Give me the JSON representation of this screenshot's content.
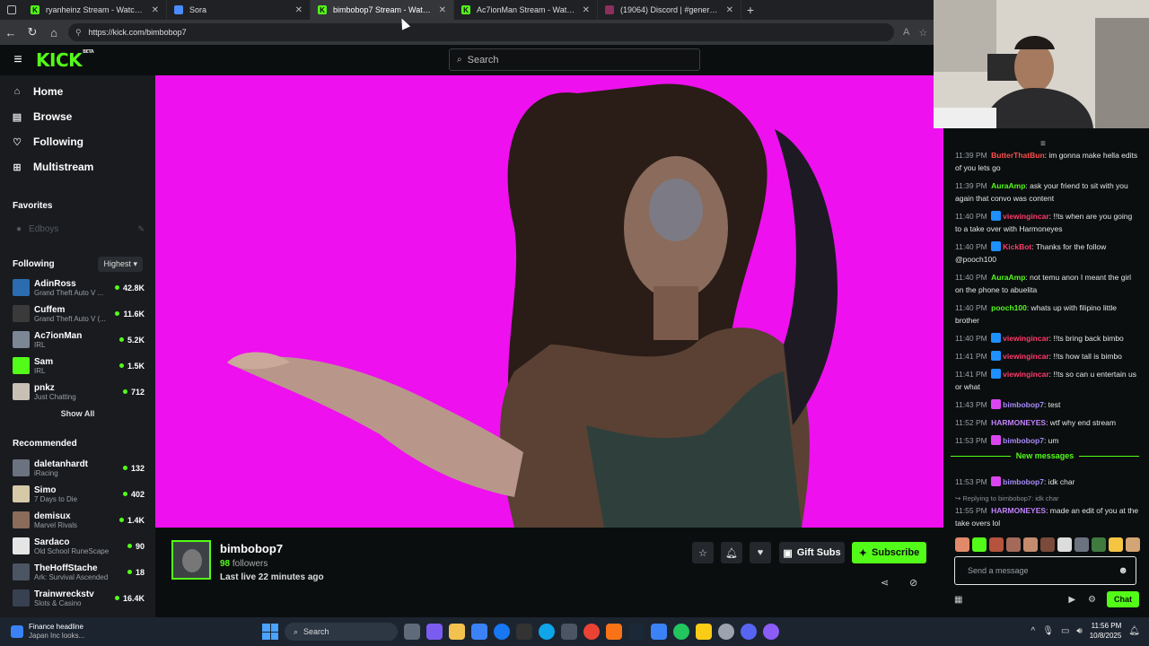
{
  "browser": {
    "tabs": [
      {
        "label": "ryanheinz Stream - Watch Li",
        "favicon": "kick",
        "color": "#53fc18",
        "active": false
      },
      {
        "label": "Sora",
        "favicon": "sora",
        "color": "#4a8cff",
        "active": false
      },
      {
        "label": "bimbobop7 Stream - Watch Live",
        "favicon": "kick",
        "color": "#53fc18",
        "active": true
      },
      {
        "label": "Ac7ionMan Stream - Watch Live",
        "favicon": "kick",
        "color": "#53fc18",
        "active": false
      },
      {
        "label": "(19064) Discord | #general | Harm",
        "favicon": "discord",
        "color": "#8d2f5c",
        "active": false
      }
    ],
    "url": "https://kick.com/bimbobop7"
  },
  "header": {
    "logo": "KICK",
    "logo_tag": "BETA",
    "search_placeholder": "Search"
  },
  "sidebar": {
    "nav": [
      {
        "label": "Home",
        "icon": "home-icon",
        "glyph": "⌂"
      },
      {
        "label": "Browse",
        "icon": "browse-icon",
        "glyph": "▤"
      },
      {
        "label": "Following",
        "icon": "heart-icon",
        "glyph": "♡"
      },
      {
        "label": "Multistream",
        "icon": "grid-icon",
        "glyph": "⊞"
      }
    ],
    "favorites_title": "Favorites",
    "favorites": [
      {
        "label": "Edboys"
      }
    ],
    "following_title": "Following",
    "sort_label": "Highest",
    "following": [
      {
        "name": "AdinRoss",
        "category": "Grand Theft Auto V ...",
        "count": "42.8K",
        "color": "#2b6cb0"
      },
      {
        "name": "Cuffem",
        "category": "Grand Theft Auto V (...",
        "count": "11.6K",
        "color": "#3a3a3a"
      },
      {
        "name": "Ac7ionMan",
        "category": "IRL",
        "count": "5.2K",
        "color": "#7c8795"
      },
      {
        "name": "Sam",
        "category": "IRL",
        "count": "1.5K",
        "color": "#53fc18"
      },
      {
        "name": "pnkz",
        "category": "Just Chatting",
        "count": "712",
        "color": "#c9c0b5"
      }
    ],
    "show_all": "Show All",
    "recommended_title": "Recommended",
    "recommended": [
      {
        "name": "daletanhardt",
        "category": "iRacing",
        "count": "132",
        "color": "#6b7280"
      },
      {
        "name": "Simo",
        "category": "7 Days to Die",
        "count": "402",
        "color": "#d6c9a8"
      },
      {
        "name": "demisux",
        "category": "Marvel Rivals",
        "count": "1.4K",
        "color": "#8b6b5a"
      },
      {
        "name": "Sardaco",
        "category": "Old School RuneScape",
        "count": "90",
        "color": "#e5e5e5"
      },
      {
        "name": "TheHoffStache",
        "category": "Ark: Survival Ascended",
        "count": "18",
        "color": "#4b5563"
      },
      {
        "name": "Trainwreckstv",
        "category": "Slots & Casino",
        "count": "16.4K",
        "color": "#374151"
      }
    ]
  },
  "stream": {
    "name": "bimbobop7",
    "followers_count": "98",
    "followers_label": "followers",
    "last_live": "Last live 22 minutes ago",
    "gift_label": "Gift Subs",
    "subscribe_label": "Subscribe"
  },
  "chat": {
    "messages": [
      {
        "time": "11:39 PM",
        "user": "ButterThatBun",
        "color": "#ff4d4d",
        "badge": "",
        "text": ": im gonna make hella edits of you lets go"
      },
      {
        "time": "11:39 PM",
        "user": "AuraAmp",
        "color": "#53fc18",
        "badge": "",
        "text": ": ask your friend to sit with you again that convo was content"
      },
      {
        "time": "11:40 PM",
        "user": "viewingincar",
        "color": "#ff3b6b",
        "badge": "#1e90ff",
        "text": ": !!ts when are you going to a take over with Harmoneyes"
      },
      {
        "time": "11:40 PM",
        "user": "KickBot",
        "color": "#ff3b6b",
        "badge": "#1e90ff",
        "text": ": Thanks for the follow @pooch100"
      },
      {
        "time": "11:40 PM",
        "user": "AuraAmp",
        "color": "#53fc18",
        "badge": "",
        "text": ": not temu anon I meant the girl on the phone to abuelita"
      },
      {
        "time": "11:40 PM",
        "user": "pooch100",
        "color": "#53fc18",
        "badge": "",
        "text": ": whats up with filipino little brother"
      },
      {
        "time": "11:40 PM",
        "user": "viewingincar",
        "color": "#ff3b6b",
        "badge": "#1e90ff",
        "text": ": !!ts bring back bimbo"
      },
      {
        "time": "11:41 PM",
        "user": "viewingincar",
        "color": "#ff3b6b",
        "badge": "#1e90ff",
        "text": ": !!ts how tall is bimbo"
      },
      {
        "time": "11:41 PM",
        "user": "viewingincar",
        "color": "#ff3b6b",
        "badge": "#1e90ff",
        "text": ": !!ts so can u entertain us or what"
      },
      {
        "time": "11:43 PM",
        "user": "bimbobop7",
        "color": "#a78bfa",
        "badge": "#d946ef",
        "text": ": test"
      },
      {
        "time": "11:52 PM",
        "user": "HARMONEYES",
        "color": "#c084fc",
        "badge": "",
        "text": ": wtf why end stream"
      },
      {
        "time": "11:53 PM",
        "user": "bimbobop7",
        "color": "#a78bfa",
        "badge": "#d946ef",
        "text": ": um"
      }
    ],
    "new_messages_label": "New messages",
    "new_messages": [
      {
        "time": "11:53 PM",
        "user": "bimbobop7",
        "color": "#a78bfa",
        "badge": "#d946ef",
        "text": ": idk char",
        "reply": ""
      },
      {
        "time": "11:55 PM",
        "user": "HARMONEYES",
        "color": "#c084fc",
        "badge": "",
        "text": ": made an edit of you at the take overs lol",
        "reply": "Replying to bimbobop7: idk char"
      }
    ],
    "input_placeholder": "Send a message",
    "send_label": "Chat"
  },
  "taskbar": {
    "news_title": "Finance headline",
    "news_sub": "Japan Inc looks...",
    "search_label": "Search",
    "time": "11:56 PM",
    "date": "10/8/2025"
  }
}
